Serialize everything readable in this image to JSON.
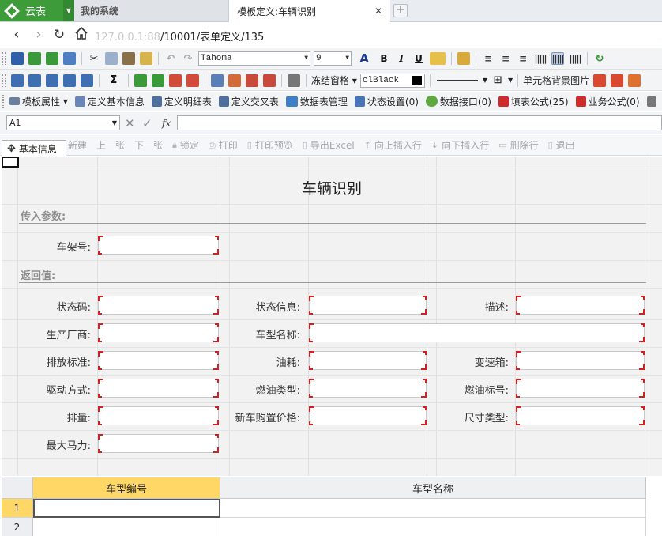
{
  "app": {
    "name": "云表",
    "logo_icon": "diamond-logo-icon",
    "accent": "#3d9b3a"
  },
  "tabs": [
    {
      "label": "我的系统"
    },
    {
      "label": "模板定义:车辆识别"
    }
  ],
  "address": {
    "url_blurred": "127.0.0.1:88",
    "url_path": "/10001/表单定义/135"
  },
  "toolbar1": {
    "font_name": "Tahoma",
    "font_size": "9",
    "icons": [
      "save-icon",
      "grid-green-icon",
      "grid-green-2-icon",
      "export-icon",
      "cut-icon",
      "copy-icon",
      "paste-icon",
      "format-painter-icon",
      "undo-icon",
      "redo-icon",
      "font-color-icon",
      "bold-icon",
      "italic-icon",
      "underline-icon",
      "fill-color-icon",
      "lock-icon",
      "align-left-icon",
      "align-center-icon",
      "align-right-icon",
      "barcode-icon",
      "barcode-2-icon",
      "barcode-3-icon",
      "refresh-icon"
    ],
    "bold": "B",
    "italic": "I",
    "underline": "U",
    "font_color_label": "A"
  },
  "toolbar2": {
    "sum_label": "Σ",
    "freeze_label": "冻结窗格",
    "color_value": "clBlack",
    "bg_image_label": "单元格背景图片"
  },
  "toolbar3": {
    "items": [
      {
        "label": "模板属性",
        "icon": "template-props-icon",
        "dropdown": true
      },
      {
        "label": "定义基本信息",
        "icon": "basic-info-icon"
      },
      {
        "label": "定义明细表",
        "icon": "detail-table-icon"
      },
      {
        "label": "定义交叉表",
        "icon": "cross-table-icon"
      },
      {
        "label": "数据表管理",
        "icon": "data-table-icon"
      },
      {
        "label": "状态设置(0)",
        "icon": "status-icon"
      },
      {
        "label": "数据接口(0)",
        "icon": "data-api-icon"
      },
      {
        "label": "填表公式(25)",
        "icon": "fill-formula-icon"
      },
      {
        "label": "业务公式(0)",
        "icon": "biz-formula-icon"
      }
    ]
  },
  "formula_bar": {
    "cell_ref": "A1",
    "fx": "fx"
  },
  "action_bar": {
    "basic_tab_label": "基本信息",
    "actions": [
      "新建",
      "上一张",
      "下一张",
      "锁定",
      "打印",
      "打印预览",
      "导出Excel",
      "向上插入行",
      "向下插入行",
      "删除行",
      "退出"
    ]
  },
  "form": {
    "title": "车辆识别",
    "section_input": "传入参数:",
    "section_return": "返回值:",
    "labels": {
      "vin": "车架号:",
      "status_code": "状态码:",
      "status_info": "状态信息:",
      "desc": "描述:",
      "manufacturer": "生产厂商:",
      "model_name": "车型名称:",
      "emission": "排放标准:",
      "fuel_consumption": "油耗:",
      "gearbox": "变速箱:",
      "drive": "驱动方式:",
      "fuel_type": "燃油类型:",
      "fuel_grade": "燃油标号:",
      "displacement": "排量:",
      "new_price": "新车购置价格:",
      "size_type": "尺寸类型:",
      "max_power": "最大马力:"
    }
  },
  "grid": {
    "columns": [
      "车型编号",
      "车型名称"
    ],
    "rows": [
      "1",
      "2"
    ],
    "header_highlight": "#ffd766"
  }
}
